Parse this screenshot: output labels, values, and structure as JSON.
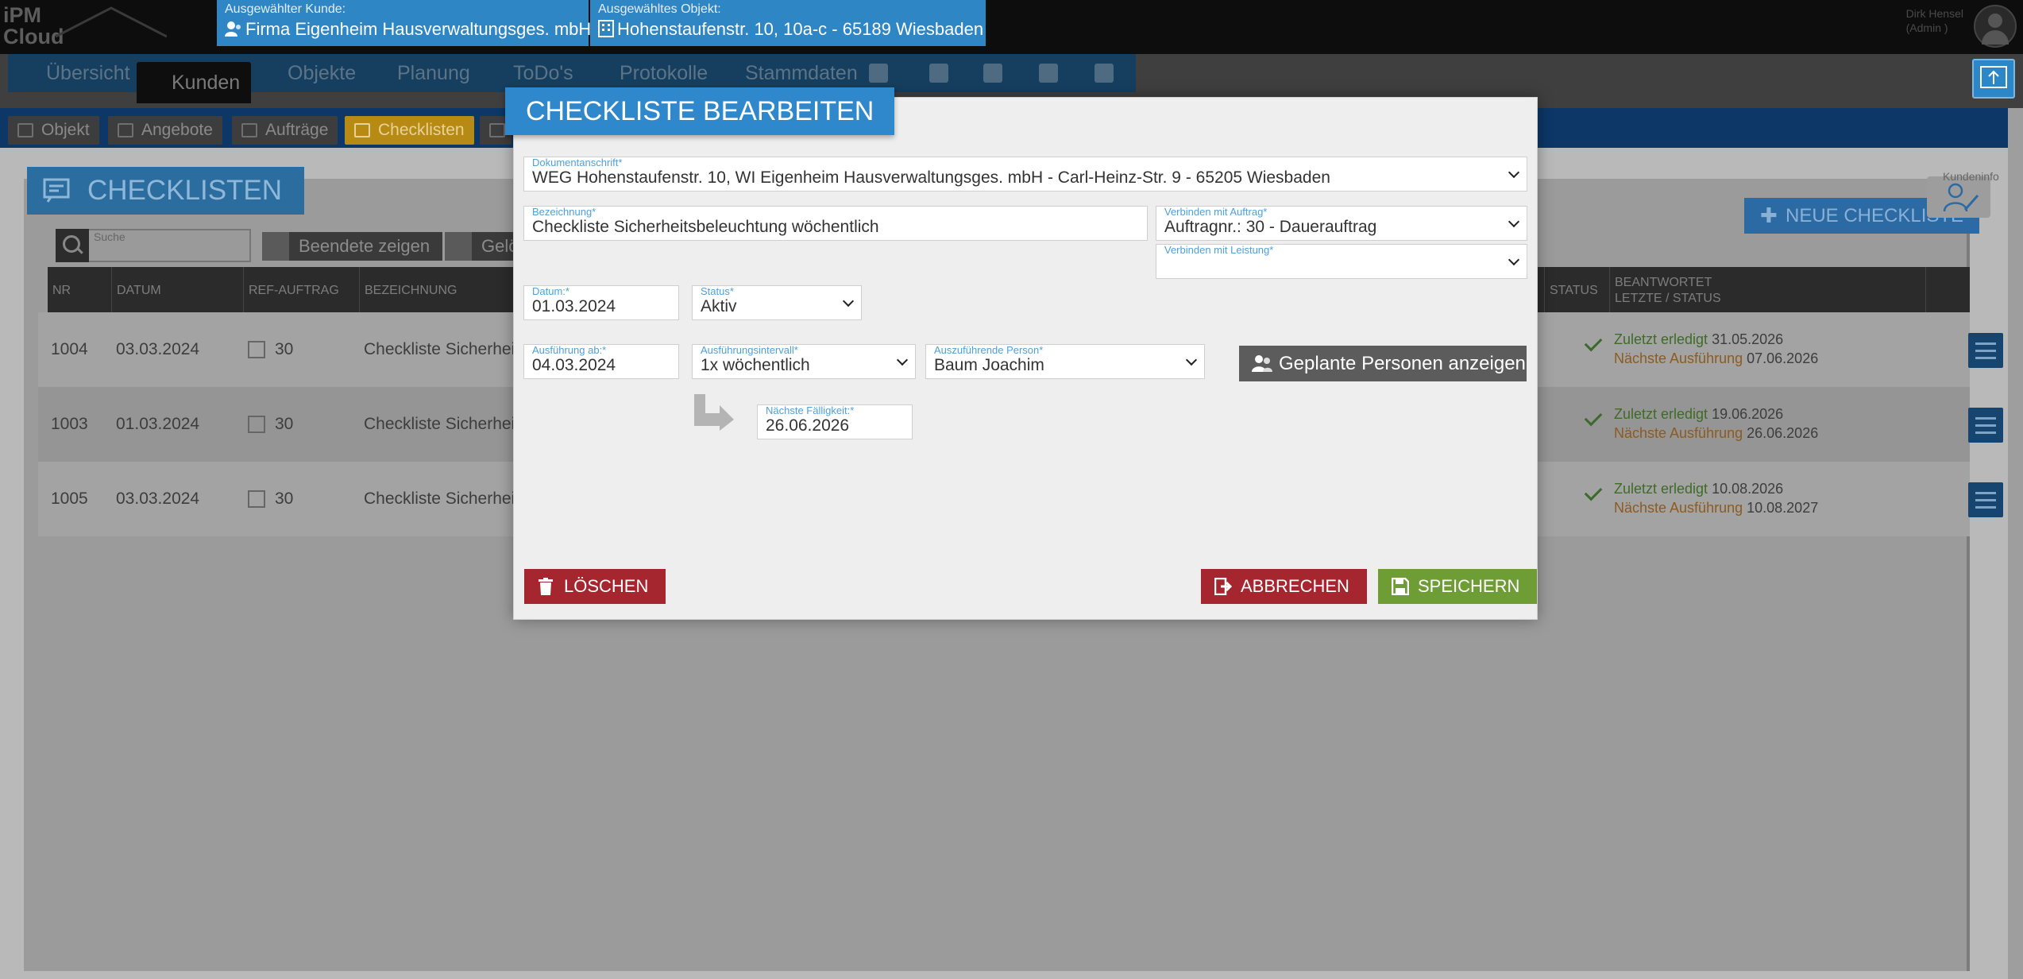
{
  "header": {
    "logo_line1": "iPM",
    "logo_line2": "Cloud",
    "customer_label": "Ausgewählter Kunde:",
    "customer_value": "Firma Eigenheim Hausverwaltungsges. mbH",
    "object_label": "Ausgewähltes Objekt:",
    "object_value": "Hohenstaufenstr. 10, 10a-c - 65189 Wiesbaden",
    "user_name": "Dirk Hensel",
    "user_role": "(Admin )"
  },
  "nav": {
    "items": [
      "Übersicht",
      "Kunden",
      "Objekte",
      "Planung",
      "ToDo's",
      "Protokolle",
      "Stammdaten"
    ],
    "icon_buttons": [
      "people-icon",
      "building-icon",
      "coins-icon",
      "gears-icon",
      "mobile-icon"
    ]
  },
  "subnav": {
    "tabs": [
      "Objekt",
      "Angebote",
      "Aufträge",
      "Checklisten"
    ],
    "active": "Checklisten"
  },
  "page": {
    "heading": "CHECKLISTEN",
    "search_label": "Suche",
    "btn_finished": "Beendete zeigen",
    "btn_deleted": "Gelöscht",
    "btn_new": "NEUE CHECKLISTE",
    "kundeninfo": "Kundeninfo"
  },
  "table": {
    "columns": {
      "nr": "NR",
      "datum": "DATUM",
      "ref": "REF-AUFTRAG",
      "bezeichnung": "BEZEICHNUNG",
      "status": "STATUS",
      "beantwortet_1": "BEANTWORTET",
      "beantwortet_2": "LETZTE / STATUS"
    },
    "rows": [
      {
        "nr": "1004",
        "datum": "03.03.2024",
        "ref": "30",
        "bezeichnung": "Checkliste Sicherheits",
        "last_label": "Zuletzt erledigt",
        "last_date": "31.05.2026",
        "next_label": "Nächste Ausführung",
        "next_date": "07.06.2026"
      },
      {
        "nr": "1003",
        "datum": "01.03.2024",
        "ref": "30",
        "bezeichnung": "Checkliste Sicherheits",
        "last_label": "Zuletzt erledigt",
        "last_date": "19.06.2026",
        "next_label": "Nächste Ausführung",
        "next_date": "26.06.2026"
      },
      {
        "nr": "1005",
        "datum": "03.03.2024",
        "ref": "30",
        "bezeichnung": "Checkliste Sicherheits",
        "last_label": "Zuletzt erledigt",
        "last_date": "10.08.2026",
        "next_label": "Nächste Ausführung",
        "next_date": "10.08.2027"
      }
    ]
  },
  "modal": {
    "title": "CHECKLISTE BEARBEITEN",
    "dokumentanschrift": {
      "label": "Dokumentanschrift*",
      "value": "WEG Hohenstaufenstr. 10, WI Eigenheim Hausverwaltungsges. mbH - Carl-Heinz-Str. 9 - 65205 Wiesbaden"
    },
    "bezeichnung": {
      "label": "Bezeichnung*",
      "value": "Checkliste Sicherheitsbeleuchtung wöchentlich"
    },
    "auftrag": {
      "label": "Verbinden mit Auftrag*",
      "value": "Auftragnr.: 30 - Dauerauftrag"
    },
    "leistung": {
      "label": "Verbinden mit Leistung*",
      "value": ""
    },
    "datum": {
      "label": "Datum:*",
      "value": "01.03.2024"
    },
    "status": {
      "label": "Status*",
      "value": "Aktiv"
    },
    "ausfuehrung_ab": {
      "label": "Ausführung ab:*",
      "value": "04.03.2024"
    },
    "intervall": {
      "label": "Ausführungsintervall*",
      "value": "1x wöchentlich"
    },
    "person": {
      "label": "Auszuführende Person*",
      "value": "Baum Joachim"
    },
    "btn_personen": "Geplante Personen anzeigen",
    "faelligkeit": {
      "label": "Nächste Fälligkeit:*",
      "value": "26.06.2026"
    },
    "btn_delete": "LÖSCHEN",
    "btn_cancel": "ABBRECHEN",
    "btn_save": "SPEICHERN"
  },
  "colors": {
    "accent_blue": "#2f88cb",
    "danger_red": "#a5262e",
    "save_green": "#6e9d36",
    "tab_active": "#b68a13"
  }
}
